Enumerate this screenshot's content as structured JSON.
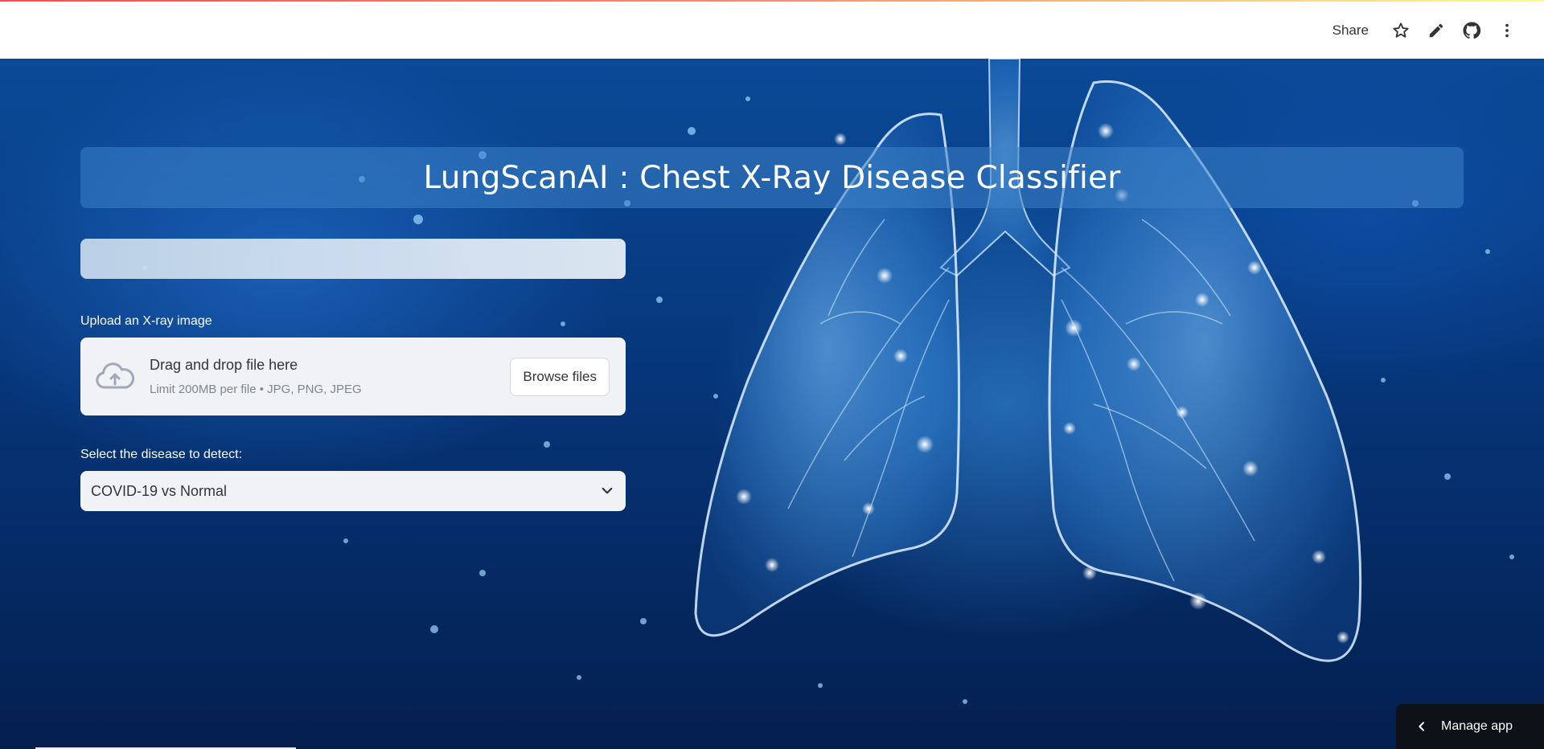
{
  "header": {
    "share_label": "Share",
    "icons": [
      "star-icon",
      "pencil-icon",
      "github-icon",
      "more-vertical-icon"
    ]
  },
  "main": {
    "title": "LungScanAI : Chest X-Ray Disease Classifier",
    "uploader": {
      "label": "Upload an X-ray image",
      "drop_title": "Drag and drop file here",
      "drop_hint": "Limit 200MB per file • JPG, PNG, JPEG",
      "browse_label": "Browse files",
      "icon": "cloud-upload-icon"
    },
    "disease_select": {
      "label": "Select the disease to detect:",
      "value": "COVID-19 vs Normal",
      "icon": "chevron-down-icon"
    }
  },
  "footer": {
    "manage_app_label": "Manage app",
    "icon": "chevron-left-icon"
  },
  "colors": {
    "accent_gradient_start": "#ff4b4b",
    "accent_gradient_end": "#fffd80",
    "background_dark": "#041f4f",
    "widget_bg": "#f0f2f6",
    "text": "#31333f"
  }
}
